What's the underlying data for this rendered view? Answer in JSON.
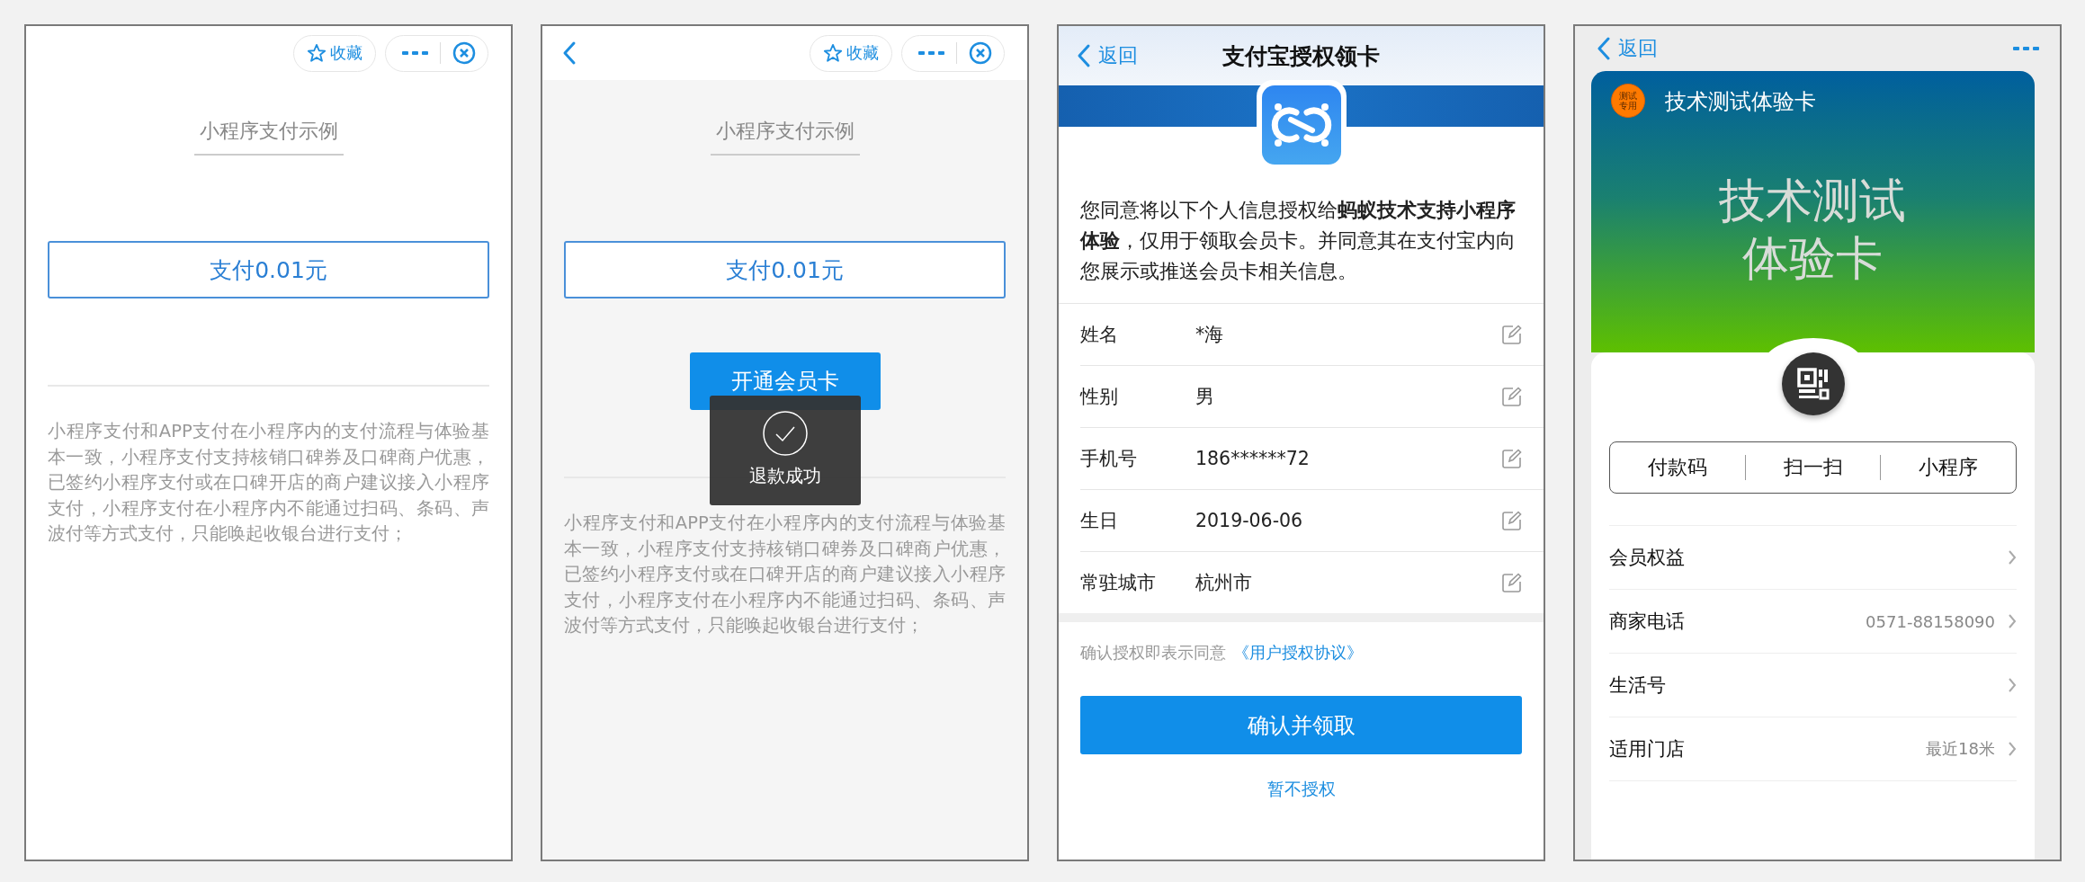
{
  "pay_screens": [
    {
      "back_button": false,
      "favorite": "收藏",
      "title": "小程序支付示例",
      "pay_button": "支付0.01元",
      "description": "小程序支付和APP支付在小程序内的支付流程与体验基本一致，小程序支付支持核销口碑券及口碑商户优惠，已签约小程序支付或在口碑开店的商户建议接入小程序支付，小程序支付在小程序内不能通过扫码、条码、声波付等方式支付，只能唤起收银台进行支付；"
    },
    {
      "back_button": true,
      "favorite": "收藏",
      "title": "小程序支付示例",
      "pay_button": "支付0.01元",
      "member_button": "开通会员卡",
      "toast": "退款成功",
      "description": "小程序支付和APP支付在小程序内的支付流程与体验基本一致，小程序支付支持核销口碑券及口碑商户优惠，已签约小程序支付或在口碑开店的商户建议接入小程序支付，小程序支付在小程序内不能通过扫码、条码、声波付等方式支付，只能唤起收银台进行支付；"
    }
  ],
  "auth_screen": {
    "back": "返回",
    "title": "支付宝授权领卡",
    "consent": "您同意将以下个人信息授权给**蚂蚁技术支持小程序体验**，仅用于领取会员卡。并同意其在支付宝内向您展示或推送会员卡相关信息。",
    "fields": [
      {
        "label": "姓名",
        "value": "*海"
      },
      {
        "label": "性别",
        "value": "男"
      },
      {
        "label": "手机号",
        "value": "186******72"
      },
      {
        "label": "生日",
        "value": "2019-06-06"
      },
      {
        "label": "常驻城市",
        "value": "杭州市"
      }
    ],
    "agreement": "确认授权即表示同意",
    "agreement_link": "《用户授权协议》",
    "confirm_button": "确认并领取",
    "decline_link": "暂不授权"
  },
  "card_screen": {
    "back": "返回",
    "badge": "测试专用",
    "card_name": "技术测试体验卡",
    "card_face": "技术测试体验卡",
    "actions": [
      "付款码",
      "扫一扫",
      "小程序"
    ],
    "rows": [
      {
        "label": "会员权益"
      },
      {
        "label": "商家电话",
        "value": "0571-88158090"
      },
      {
        "label": "生活号"
      },
      {
        "label": "适用门店",
        "value": "最近18米"
      }
    ]
  }
}
